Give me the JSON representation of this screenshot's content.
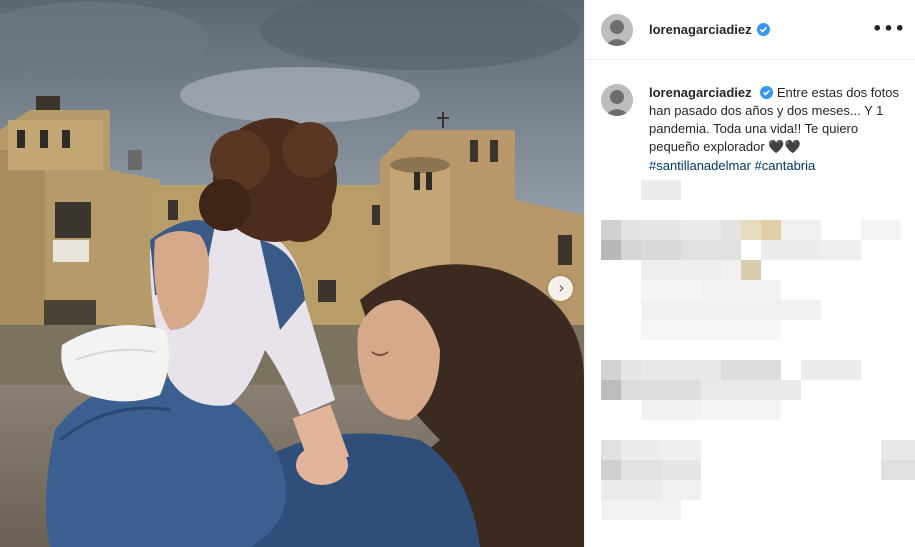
{
  "post": {
    "username": "lorenagarciadiez",
    "caption_text": "Entre estas dos fotos han pasado dos años y dos meses... Y 1 pandemia. Toda una vida!! Te quiero pequeño explorador",
    "caption_emoji": "🖤🖤",
    "hashtags": [
      "#santillanadelmar",
      "#cantabria"
    ]
  },
  "icons": {
    "verified": "verified-badge-icon",
    "more": "more-options-icon",
    "next": "chevron-right-icon"
  },
  "colors": {
    "verified_blue": "#3897f0",
    "hashtag": "#00376b",
    "text": "#262626",
    "border": "#efefef"
  }
}
